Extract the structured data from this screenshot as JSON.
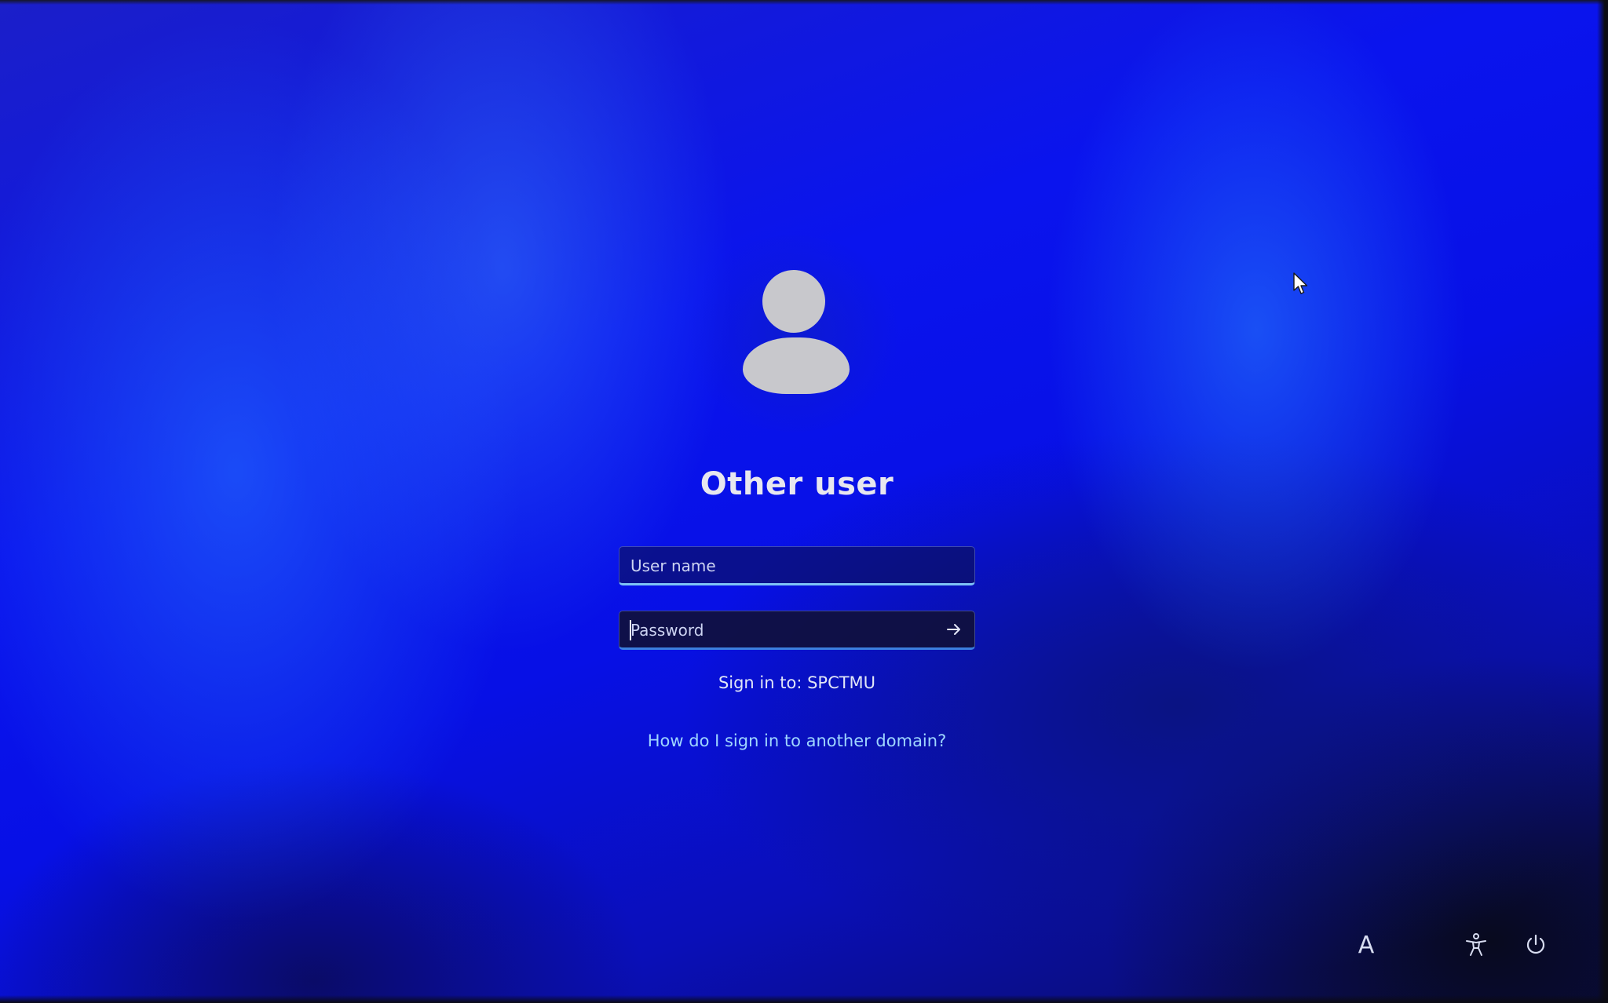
{
  "login": {
    "title": "Other user",
    "username_placeholder": "User name",
    "password_placeholder": "Password",
    "sign_in_to": "Sign in to: SPCTMU",
    "domain_help_link": "How do I sign in to another domain?"
  },
  "bottom_bar": {
    "language_label": "A",
    "accessibility_icon": "accessibility-icon",
    "power_icon": "power-icon"
  },
  "colors": {
    "background_blue": "#0a14ee",
    "username_underline": "#7ec3f5",
    "password_underline": "#3b7fe0",
    "link": "#9fd6ff"
  }
}
